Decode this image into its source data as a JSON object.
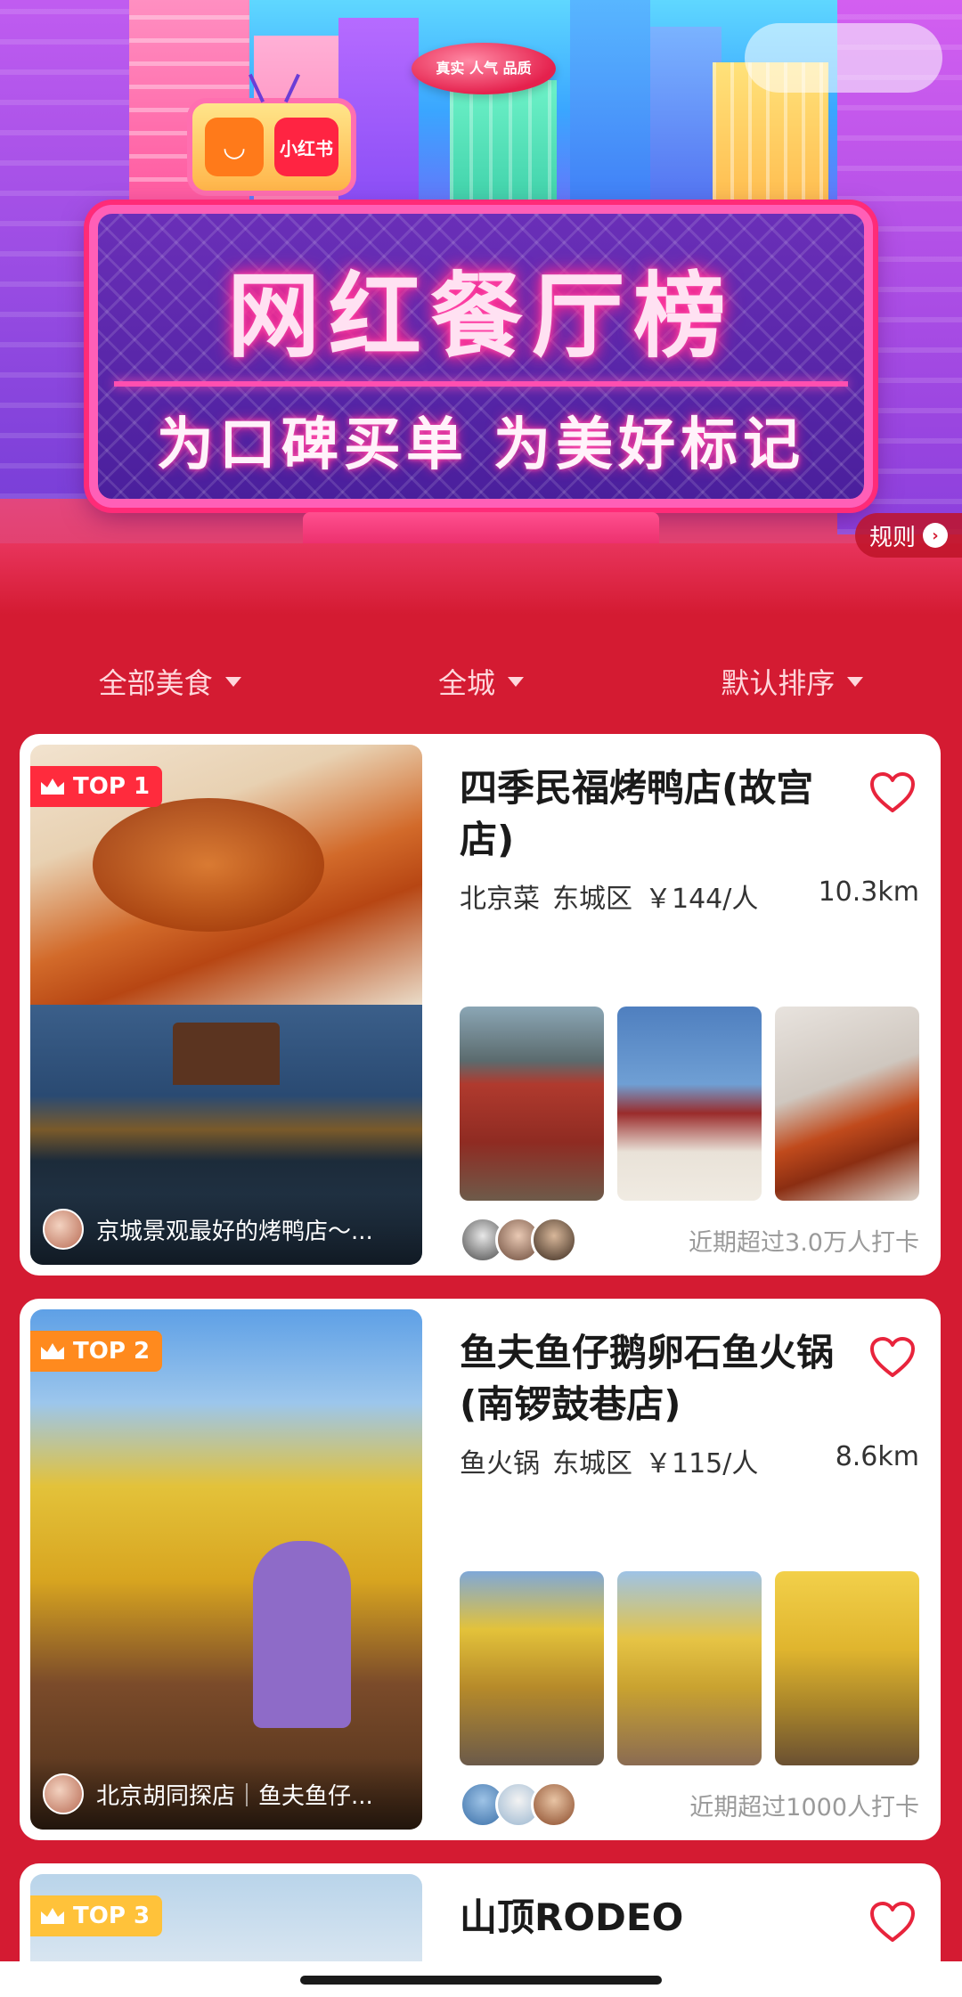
{
  "banner": {
    "logo_label": "小红书",
    "logo_glyph": "◡",
    "blimp_text": "真实 人气 品质",
    "title": "网红餐厅榜",
    "subtitle": "为口碑买单 为美好标记",
    "rules_label": "规则",
    "rules_arrow": "›"
  },
  "filters": [
    {
      "label": "全部美食"
    },
    {
      "label": "全城"
    },
    {
      "label": "默认排序"
    }
  ],
  "restaurants": [
    {
      "rank": "TOP 1",
      "name": "四季民福烤鸭店(故宫店)",
      "cuisine": "北京菜",
      "district": "东城区",
      "price": "￥144/人",
      "distance": "10.3km",
      "caption": "京城景观最好的烤鸭店～...",
      "checkins": "近期超过3.0万人打卡"
    },
    {
      "rank": "TOP 2",
      "name": "鱼夫鱼仔鹅卵石鱼火锅(南锣鼓巷店)",
      "cuisine": "鱼火锅",
      "district": "东城区",
      "price": "￥115/人",
      "distance": "8.6km",
      "caption": "北京胡同探店｜鱼夫鱼仔...",
      "checkins": "近期超过1000人打卡"
    },
    {
      "rank": "TOP 3",
      "name": "山顶RODEO"
    }
  ],
  "colors": {
    "page_bg": "#d41b32",
    "top1_badge": "#ff2b3d",
    "top2_badge": "#ff8a1e",
    "top3_badge": "#ffc23a",
    "heart": "#e8243c"
  }
}
